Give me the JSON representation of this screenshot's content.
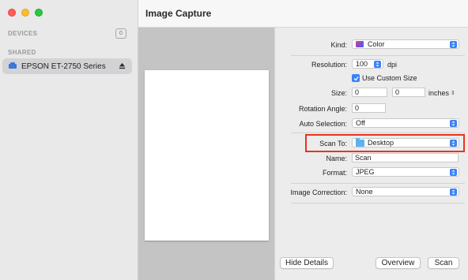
{
  "window": {
    "title": "Image Capture"
  },
  "sidebar": {
    "devices_label": "DEVICES",
    "devices_count": "0",
    "shared_label": "SHARED",
    "device": {
      "name": "EPSON ET-2750 Series",
      "icon": "scanner-icon"
    }
  },
  "settings": {
    "kind": {
      "label": "Kind:",
      "value": "Color"
    },
    "resolution": {
      "label": "Resolution:",
      "value": "100",
      "unit": "dpi"
    },
    "custom_size": {
      "label": "Use Custom Size",
      "checked": true
    },
    "size": {
      "label": "Size:",
      "width": "0",
      "height": "0",
      "unit": "inches"
    },
    "rotation": {
      "label": "Rotation Angle:",
      "value": "0"
    },
    "auto_selection": {
      "label": "Auto Selection:",
      "value": "Off"
    },
    "scan_to": {
      "label": "Scan To:",
      "value": "Desktop"
    },
    "name": {
      "label": "Name:",
      "value": "Scan"
    },
    "format": {
      "label": "Format:",
      "value": "JPEG"
    },
    "image_correction": {
      "label": "Image Correction:",
      "value": "None"
    }
  },
  "buttons": {
    "hide_details": "Hide Details",
    "overview": "Overview",
    "scan": "Scan"
  },
  "colors": {
    "accent": "#3a82f6",
    "highlight": "#e8331f"
  }
}
